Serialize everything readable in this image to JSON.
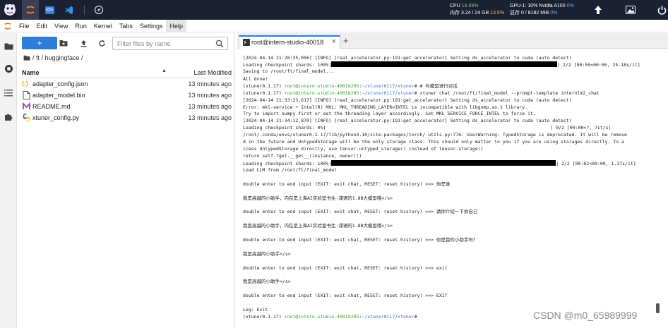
{
  "topbar": {
    "stats_left": {
      "cpu_label": "CPU",
      "cpu_value": "19.69%",
      "mem_label": "内存 3.24 / 24 GB",
      "mem_pct": "13.5%"
    },
    "stats_right": {
      "gpu_label": "GPU-1: 10% Nvidia A100",
      "gpu_pct": "0%",
      "vram_label": "显存 0 / 8182 MiB",
      "vram_pct": "0%"
    }
  },
  "menu": [
    "File",
    "Edit",
    "View",
    "Run",
    "Kernel",
    "Tabs",
    "Settings",
    "Help"
  ],
  "file_browser": {
    "new_label": "+",
    "filter_placeholder": "Filter files by name",
    "breadcrumb": "/ ft / huggingface /",
    "col_name": "Name",
    "col_modified": "Last Modified",
    "files": [
      {
        "name": "adapter_config.json",
        "modified": "13 minutes ago",
        "icon": "json-icon"
      },
      {
        "name": "adapter_model.bin",
        "modified": "13 minutes ago",
        "icon": "file-icon"
      },
      {
        "name": "README.md",
        "modified": "13 minutes ago",
        "icon": "markdown-icon"
      },
      {
        "name": "xtuner_config.py",
        "modified": "13 minutes ago",
        "icon": "python-icon"
      }
    ]
  },
  "terminal_tab": {
    "label": "root@intern-studio-40018",
    "close": "×",
    "add": "+"
  },
  "terminal": {
    "l1": "[2024-04-14 21:28:35,056] [INFO] [real_accelerator.py:191:get_accelerator] Setting ds_accelerator to cuda (auto detect)",
    "l2a": "Loading checkpoint shards: 100%|",
    "l2b": "| 2/2 [00:50<00:00, 25.18s/it]",
    "l3": "Saving to /root/ft/final_model...",
    "l4": "All done!",
    "l5a": "(xtuner0.1.17) ",
    "l5b": "root@intern-studio-40018295",
    "l5c": ":",
    "l5d": "~/xtuner0117/xtuner",
    "l5e": "# # 与模型进行对话",
    "l6a": "(xtuner0.1.17) ",
    "l6b": "root@intern-studio-40018295",
    "l6c": ":",
    "l6d": "~/xtuner0117/xtuner",
    "l6e": "# xtuner chat /root/ft/final_model --prompt-template internlm2_chat",
    "l7": "[2024-04-14 21:33:23,617] [INFO] [real_accelerator.py:191:get_accelerator] Setting ds_accelerator to cuda (auto detect)",
    "l8": "Error: mkl-service + Intel(R) MKL: MKL_THREADING_LAYER=INTEL is incompatible with libgomp.so.1 library.",
    "l9": "        Try to import numpy first or set the threading layer accordingly. Set MKL_SERVICE_FORCE_INTEL to force it.",
    "l10": "[2024-04-14 21:34:12,870] [INFO] [real_accelerator.py:191:get_accelerator] Setting ds_accelerator to cuda (auto detect)",
    "l11a": "Loading checkpoint shards:   0%|",
    "l11b": "| 0/2 [00:00<?, ?it/s]",
    "l12": "/root/.conda/envs/xtuner0.1.17/lib/python3.10/site-packages/torch/_utils.py:776: UserWarning: TypedStorage is deprecated. It will be remove",
    "l13": "d in the future and UntypedStorage will be the only storage class. This should only matter to you if you are using storages directly.  To a",
    "l14": "ccess UntypedStorage directly, use tensor.untyped_storage() instead of tensor.storage()",
    "l15": "  return self.fget.__get__(instance, owner)()",
    "l16a": "Loading checkpoint shards: 100%|",
    "l16b": "| 2/2 [00:02<00:00,  1.37s/it]",
    "l17": "Load LLM from /root/ft/final_model",
    "q1": "double enter to end input (EXIT: exit chat, RESET: reset history) >>> 你是谁",
    "a1": "我是高越的小助手，内在是上海AI实验室书生·浦语的1.8B大模型哦</s>",
    "q2": "double enter to end input (EXIT: exit chat, RESET: reset history) >>> 请你介绍一下你自己",
    "a2": "我是高越的小助手，内在是上海AI实验室书生·浦语的1.8B大模型哦</s>",
    "q3": "double enter to end input (EXIT: exit chat, RESET: reset history) >>> 你是我的小助手吗？",
    "a3": "我是高越的小助手</s>",
    "q4": "double enter to end input (EXIT: exit chat, RESET: reset history) >>> exit",
    "a4": "我是高越的小助手</s>",
    "q5": "double enter to end input (EXIT: exit chat, RESET: reset history) >>> EXIT",
    "l_exit": "Log: Exit",
    "lp_a": "(xtuner0.1.17) ",
    "lp_b": "root@intern-studio-40018295",
    "lp_c": ":",
    "lp_d": "~/xtuner0117/xtuner",
    "lp_e": "#"
  },
  "watermark": "CSDN @m0_65989999",
  "colors": {
    "topbar": "#1c2033",
    "accent": "#2f7dd9",
    "prompt_green": "#2e9e2e",
    "path_blue": "#3a6fc9"
  }
}
